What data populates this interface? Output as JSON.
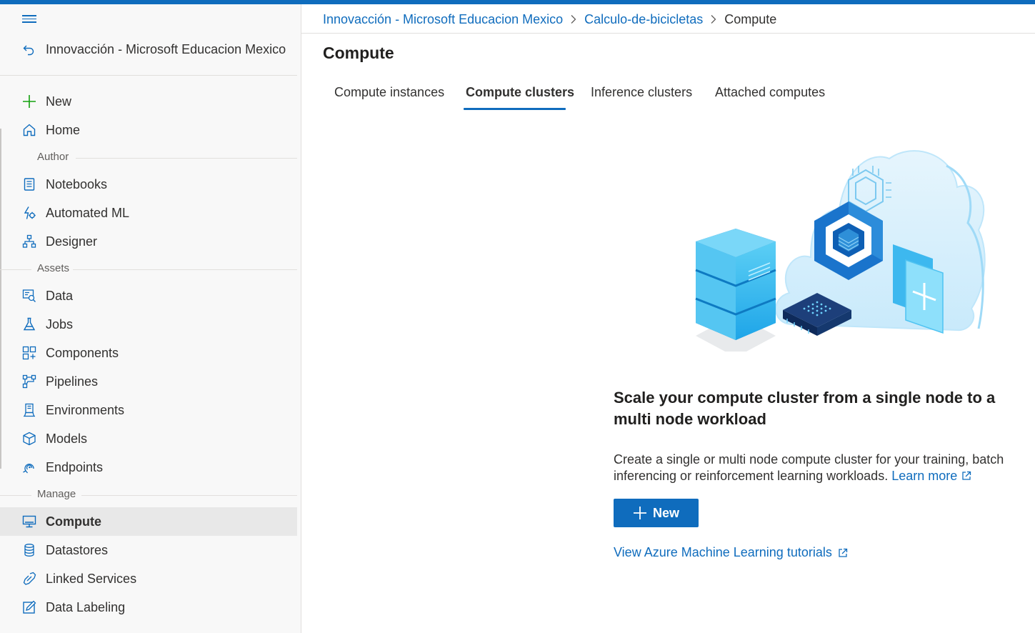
{
  "colors": {
    "accent": "#0f6cbd",
    "active_bg": "#e8e8e8",
    "sidebar_bg": "#f8f8f8"
  },
  "sidebar": {
    "menu_icon": "hamburger-icon",
    "workspace_back_icon": "back-arrow-icon",
    "workspace_name": "Innovacción - Microsoft Educacion Mexico",
    "new_label": "New",
    "home_label": "Home",
    "sections": {
      "author": "Author",
      "assets": "Assets",
      "manage": "Manage"
    },
    "author_items": [
      {
        "label": "Notebooks",
        "icon": "notebook-icon"
      },
      {
        "label": "Automated ML",
        "icon": "automated-ml-icon"
      },
      {
        "label": "Designer",
        "icon": "designer-icon"
      }
    ],
    "asset_items": [
      {
        "label": "Data",
        "icon": "data-icon"
      },
      {
        "label": "Jobs",
        "icon": "flask-icon"
      },
      {
        "label": "Components",
        "icon": "components-icon"
      },
      {
        "label": "Pipelines",
        "icon": "pipelines-icon"
      },
      {
        "label": "Environments",
        "icon": "environments-icon"
      },
      {
        "label": "Models",
        "icon": "cube-icon"
      },
      {
        "label": "Endpoints",
        "icon": "endpoints-icon"
      }
    ],
    "manage_items": [
      {
        "label": "Compute",
        "icon": "monitor-icon",
        "active": true
      },
      {
        "label": "Datastores",
        "icon": "database-icon"
      },
      {
        "label": "Linked Services",
        "icon": "link-icon"
      },
      {
        "label": "Data Labeling",
        "icon": "edit-icon"
      }
    ]
  },
  "breadcrumb": {
    "workspace": "Innovacción - Microsoft Educacion Mexico",
    "project": "Calculo-de-bicicletas",
    "current": "Compute"
  },
  "page_title": "Compute",
  "tabs": [
    {
      "label": "Compute instances"
    },
    {
      "label": "Compute clusters",
      "active": true
    },
    {
      "label": "Inference clusters"
    },
    {
      "label": "Attached computes"
    }
  ],
  "empty_state": {
    "illustration": "cloud-compute-illustration",
    "title": "Scale your compute cluster from a single node to a multi node workload",
    "description": "Create a single or multi node compute cluster for your training, batch inferencing or reinforcement learning workloads.",
    "learn_more": "Learn more",
    "new_button": "New",
    "tutorials_link": "View Azure Machine Learning tutorials"
  }
}
